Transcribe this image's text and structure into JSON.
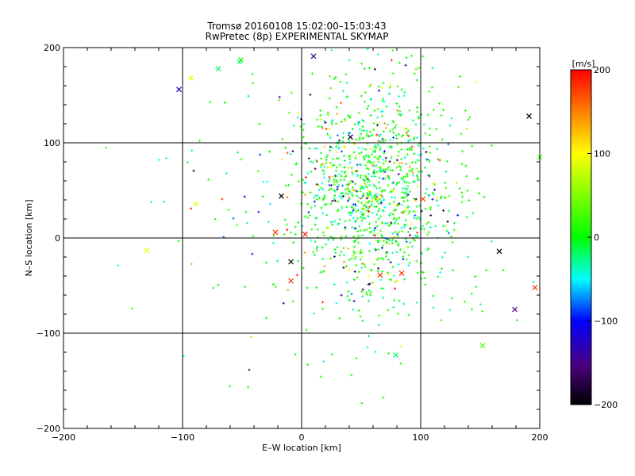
{
  "chart_data": {
    "type": "scatter",
    "title": "Tromsø 20160108 15:02:00–15:03:43",
    "subtitle": "RwPretec (8p) EXPERIMENTAL SKYMAP",
    "xlabel": "E–W location [km]",
    "ylabel": "N–S location [km]",
    "xlim": [
      -200,
      200
    ],
    "ylim": [
      -200,
      200
    ],
    "xticks": [
      -200,
      -100,
      0,
      100,
      200
    ],
    "yticks": [
      -200,
      -100,
      0,
      100,
      200
    ],
    "x_tick_labels": [
      "−200",
      "−100",
      "0",
      "100",
      "200"
    ],
    "y_tick_labels": [
      "−200",
      "−100",
      "0",
      "100",
      "200"
    ],
    "grid_lines": [
      -100,
      0,
      100
    ],
    "grid": true,
    "colorbar": {
      "label": "[m/s]",
      "range": [
        -200,
        200
      ],
      "ticks": [
        200,
        100,
        0,
        -100,
        -200
      ],
      "tick_labels": [
        "200",
        "100",
        "0",
        "−100",
        "−200"
      ],
      "colormap": [
        "#000000",
        "#4b0082",
        "#0000ff",
        "#00ffff",
        "#00ff00",
        "#ffff00",
        "#ff0000"
      ]
    },
    "points_x_marks": [
      {
        "x": -103,
        "y": 156,
        "v": -120
      },
      {
        "x": -93,
        "y": 168,
        "v": 90
      },
      {
        "x": -70,
        "y": 178,
        "v": -20
      },
      {
        "x": -52,
        "y": 185,
        "v": -30
      },
      {
        "x": -51,
        "y": 187,
        "v": 10
      },
      {
        "x": 10,
        "y": 191,
        "v": -140
      },
      {
        "x": 41,
        "y": 106,
        "v": -200
      },
      {
        "x": 191,
        "y": 128,
        "v": -200
      },
      {
        "x": 200,
        "y": 85,
        "v": 20
      },
      {
        "x": -89,
        "y": 36,
        "v": 90
      },
      {
        "x": -17,
        "y": 44,
        "v": -200
      },
      {
        "x": 102,
        "y": 41,
        "v": 170
      },
      {
        "x": -130,
        "y": -13,
        "v": 90
      },
      {
        "x": -22,
        "y": 6,
        "v": 180
      },
      {
        "x": 3,
        "y": 4,
        "v": 190
      },
      {
        "x": -9,
        "y": -25,
        "v": -200
      },
      {
        "x": -9,
        "y": -45,
        "v": 180
      },
      {
        "x": 66,
        "y": -39,
        "v": 180
      },
      {
        "x": 84,
        "y": -37,
        "v": 180
      },
      {
        "x": 166,
        "y": -14,
        "v": -200
      },
      {
        "x": 196,
        "y": -52,
        "v": 180
      },
      {
        "x": 179,
        "y": -75,
        "v": -150
      },
      {
        "x": 79,
        "y": -123,
        "v": -20
      },
      {
        "x": 152,
        "y": -113,
        "v": 30
      }
    ],
    "scatter_dots": "approximately 1,200 small colored '+' markers, densest around E–W 0 to 120 km and N–S −60 to 160 km, with velocities mostly near 0 m/s (green/cyan)"
  }
}
